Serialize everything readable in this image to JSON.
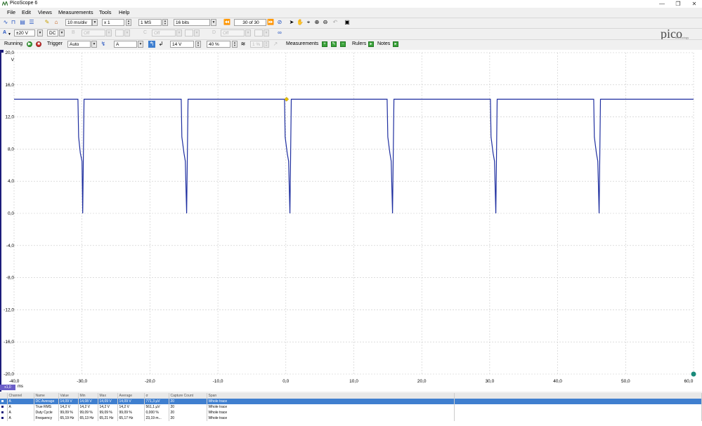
{
  "window": {
    "title": "PicoScope 6"
  },
  "menu": [
    "File",
    "Edit",
    "Views",
    "Measurements",
    "Tools",
    "Help"
  ],
  "toolbar1": {
    "timebase": "10 ms/div",
    "zoom": "x 1",
    "samples": "1 MS",
    "resolution": "16 bits",
    "buffer": "30 of 30"
  },
  "toolbar2": {
    "channel_a_label": "A",
    "range": "±20 V",
    "coupling": "DC",
    "disabled_range": "Off",
    "brand": "pico",
    "brand_sub": "Technology"
  },
  "toolbar3": {
    "status": "Running",
    "trigger_label": "Trigger",
    "trigger_mode": "Auto",
    "trigger_channel": "A",
    "threshold": "14 V",
    "pre_trigger": "40 %",
    "pre_trigger_disabled": "1 %",
    "measurements_label": "Measurements",
    "rulers_label": "Rulers",
    "notes_label": "Notes"
  },
  "colors": {
    "trace": "#1f2fa0",
    "trigger_marker": "#e8c000",
    "accent": "#3f7fcf"
  },
  "chart_data": {
    "type": "line",
    "series": [
      {
        "name": "A",
        "values_note": "",
        "x": [
          -40,
          -30.6,
          -30.5,
          -30.25,
          -30.0,
          -29.9,
          -29.7,
          -15.4,
          -15.3,
          -15.0,
          -14.8,
          -14.6,
          -14.4,
          -0.2,
          -0.1,
          0.2,
          0.4,
          0.6,
          0.8,
          14.9,
          15.0,
          15.3,
          15.5,
          15.7,
          15.9,
          30.1,
          30.2,
          30.5,
          30.7,
          30.9,
          31.1,
          45.3,
          45.4,
          45.7,
          45.9,
          46.1,
          46.3,
          60
        ],
        "y": [
          14.2,
          14.2,
          9.5,
          7.5,
          6.5,
          0.0,
          14.2,
          14.2,
          9.5,
          7.5,
          6.5,
          0.0,
          14.2,
          14.2,
          9.5,
          7.5,
          6.5,
          0.0,
          14.2,
          14.2,
          9.5,
          7.5,
          6.5,
          0.0,
          14.2,
          14.2,
          9.5,
          7.5,
          6.5,
          0.0,
          14.2,
          14.2,
          9.5,
          7.5,
          6.5,
          0.0,
          14.2,
          14.2
        ]
      }
    ],
    "title": "",
    "xlabel": "ms",
    "ylabel": "V",
    "xlim": [
      -40,
      60
    ],
    "ylim": [
      -20,
      20
    ],
    "x_ticks": [
      "-40,0",
      "-30,0",
      "-20,0",
      "-10,0",
      "0,0",
      "10,0",
      "20,0",
      "30,0",
      "40,0",
      "50,0",
      "60,0"
    ],
    "y_ticks": [
      "20,0",
      "16,0",
      "12,0",
      "8,0",
      "4,0",
      "0,0",
      "-4,0",
      "-8,0",
      "-12,0",
      "-16,0",
      "-20,0"
    ],
    "grid": true,
    "trigger_point": {
      "x": 0.1,
      "y": 14.2
    }
  },
  "measurements": {
    "headers": [
      "Channel",
      "Name",
      "Value",
      "Min",
      "Max",
      "Average",
      "σ",
      "Capture Count",
      "Span"
    ],
    "rows": [
      [
        "A",
        "DC Average",
        "14,09 V",
        "14,08 V",
        "14,09 V",
        "14,09 V",
        "771,3 µV",
        "20",
        "Whole trace"
      ],
      [
        "A",
        "True RMS",
        "14,2 V",
        "14,2 V",
        "14,2 V",
        "14,2 V",
        "561,1 µV",
        "20",
        "Whole trace"
      ],
      [
        "A",
        "Duty Cycle",
        "99,09 %",
        "99,09 %",
        "99,09 %",
        "99,09 %",
        "0,000 %",
        "20",
        "Whole trace"
      ],
      [
        "A",
        "Frequency",
        "65,19 Hz",
        "65,13 Hz",
        "65,21 Hz",
        "65,17 Hz",
        "23,19 m...",
        "20",
        "Whole trace"
      ]
    ]
  },
  "x_unit_badge": "x1,0"
}
